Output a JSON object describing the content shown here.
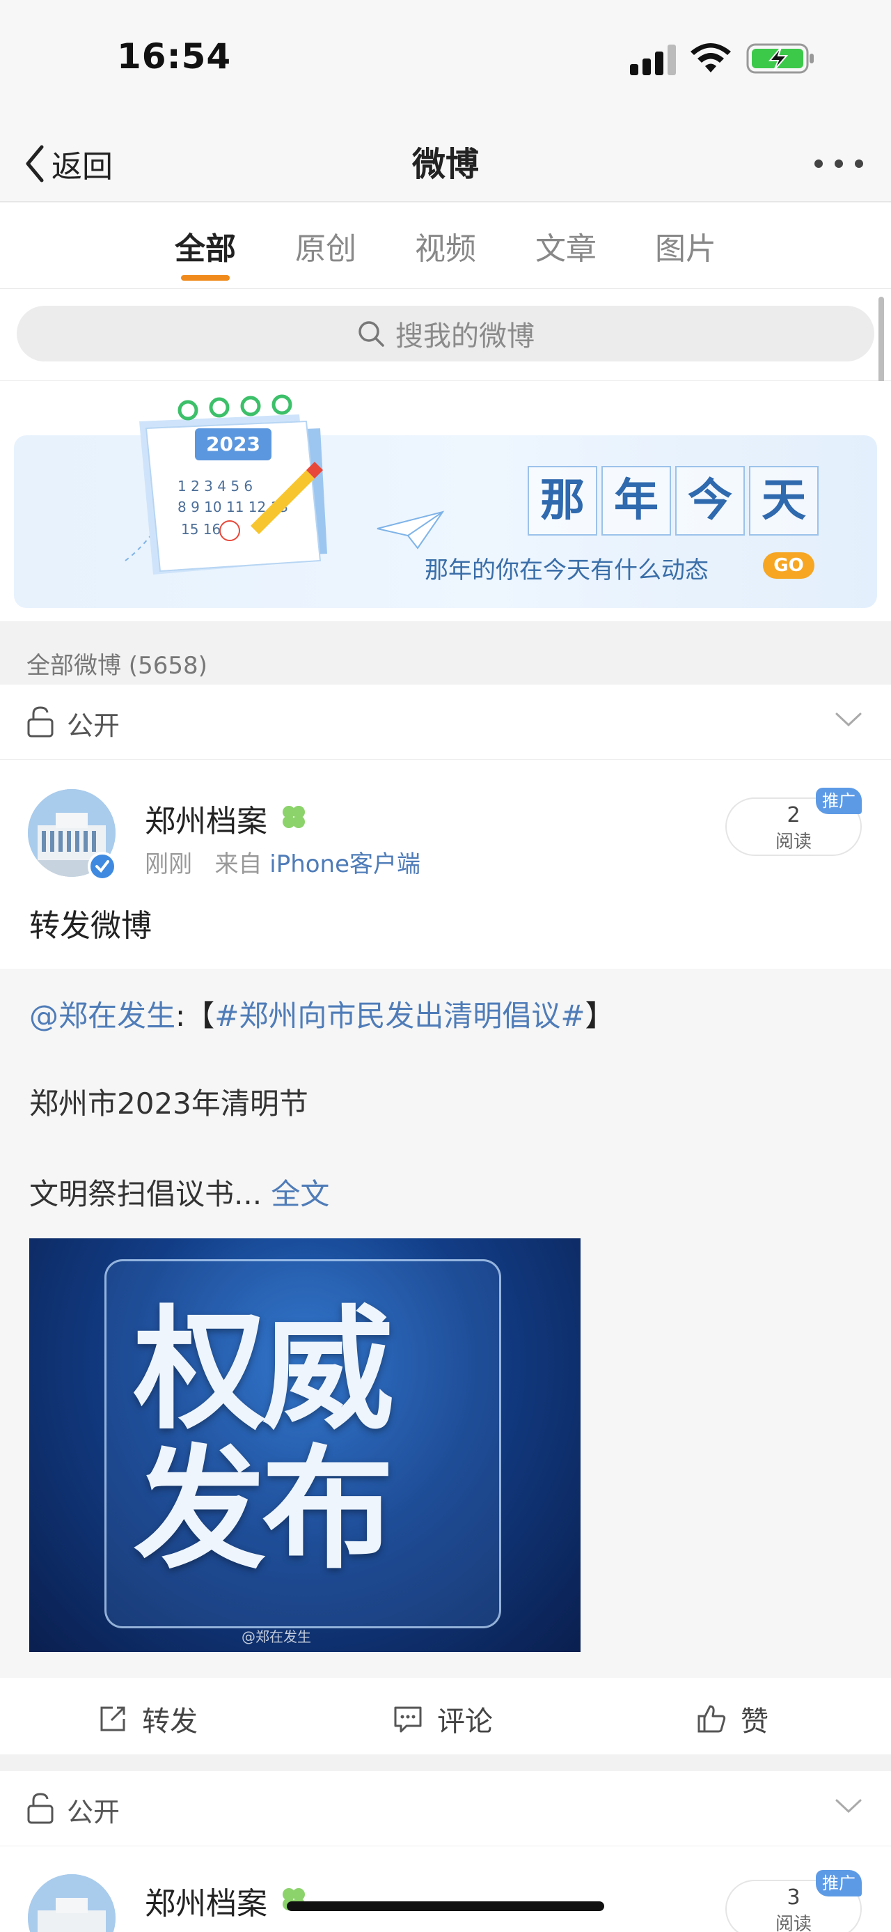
{
  "status": {
    "time": "16:54"
  },
  "nav": {
    "back_label": "返回",
    "title": "微博"
  },
  "tabs": [
    {
      "label": "全部",
      "active": true
    },
    {
      "label": "原创",
      "active": false
    },
    {
      "label": "视频",
      "active": false
    },
    {
      "label": "文章",
      "active": false
    },
    {
      "label": "图片",
      "active": false
    }
  ],
  "search": {
    "placeholder": "搜我的微博"
  },
  "banner": {
    "calendar_year": "2023",
    "title_chars": [
      "那",
      "年",
      "今",
      "天"
    ],
    "subtitle": "那年的你在今天有什么动态",
    "go_label": "GO"
  },
  "section": {
    "label": "全部微博 (5658)"
  },
  "posts": [
    {
      "visibility": "公开",
      "user": "郑州档案",
      "time": "刚刚",
      "source_prefix": "来自",
      "source": "iPhone客户端",
      "reads": "2",
      "reads_label": "阅读",
      "promo": "推广",
      "text": "转发微博",
      "repost": {
        "mention": "@郑在发生",
        "colon": ":",
        "bracket_open": "【",
        "topic": "#郑州向市民发出清明倡议#",
        "bracket_close": "】",
        "line2": "郑州市2023年清明节",
        "line3": "文明祭扫倡议书...",
        "full_text": "全文",
        "image_text_line1": "权威",
        "image_text_line2": "发布",
        "watermark": "@郑在发生"
      }
    },
    {
      "visibility": "公开",
      "user": "郑州档案",
      "reads": "3",
      "reads_label": "阅读",
      "promo": "推广"
    }
  ],
  "actions": {
    "repost": "转发",
    "comment": "评论",
    "like": "赞"
  },
  "colors": {
    "accent": "#f08a1c",
    "link": "#4f7cb8",
    "promo": "#5d9ae6"
  }
}
